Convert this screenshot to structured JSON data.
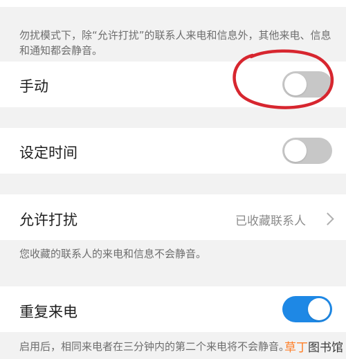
{
  "dnd_note": "勿扰模式下，除“允许打扰”的联系人来电和信息外，其他来电、信息和通知都会静音。",
  "manual": {
    "label": "手动",
    "on": false
  },
  "scheduled": {
    "label": "设定时间",
    "on": false
  },
  "allow": {
    "label": "允许打扰",
    "value": "已收藏联系人"
  },
  "allow_note": "您收藏的联系人的来电和信息不会静音。",
  "repeat_calls": {
    "label": "重复来电",
    "on": true
  },
  "repeat_note": "启用后，相同来电者在三分钟内的第二个来电将不会静音。",
  "watermark": {
    "accent": "草丁",
    "rest": "图书馆"
  },
  "colors": {
    "accent": "#1e88e5",
    "annotation": "#d7262f"
  }
}
